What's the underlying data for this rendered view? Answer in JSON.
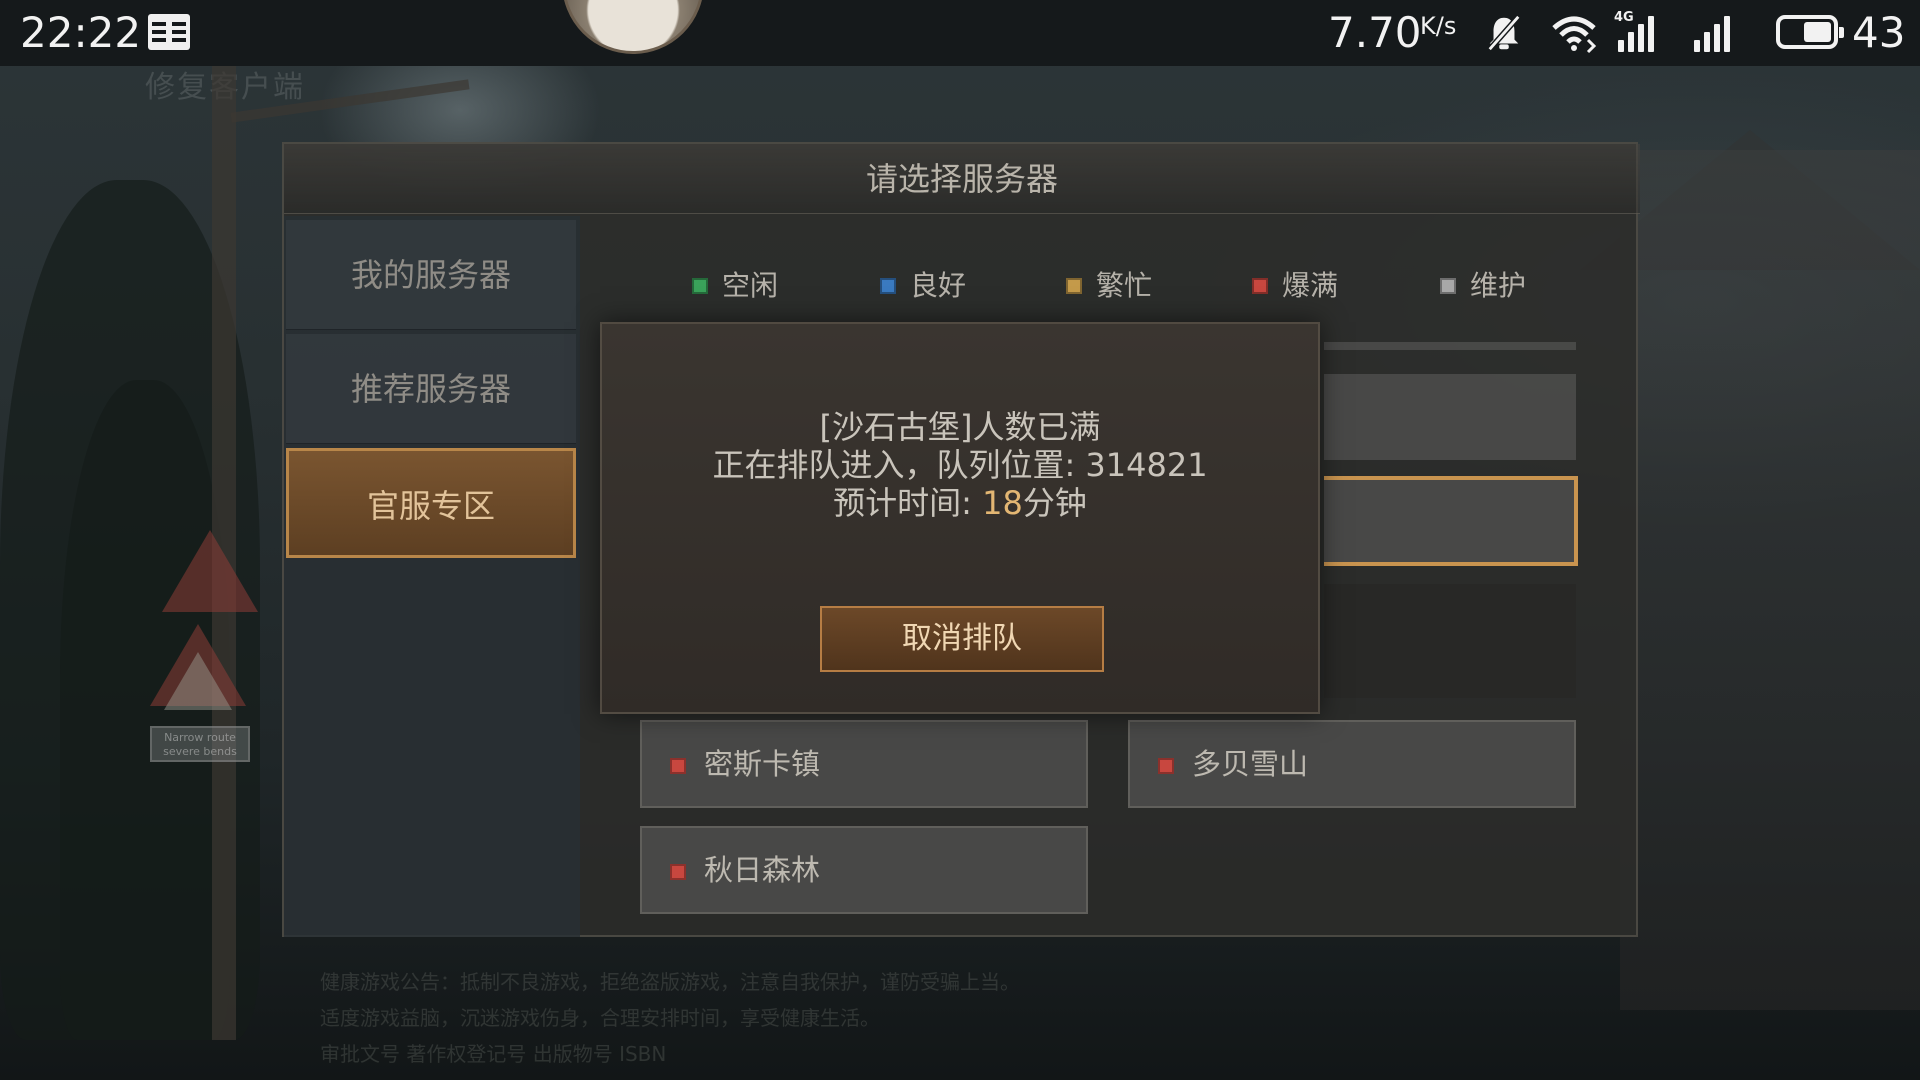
{
  "status_bar": {
    "time": "22:22",
    "net_speed": "7.70",
    "net_speed_unit": "K/s",
    "battery_level": "43",
    "icons": [
      "book-icon",
      "mute-bell-icon",
      "wifi-icon",
      "signal-4g-icon",
      "signal-icon",
      "battery-icon"
    ],
    "network_label": "4G"
  },
  "background": {
    "ghost_title": "修复客户端",
    "footer_lines": [
      "健康游戏公告：抵制不良游戏，拒绝盗版游戏，注意自我保护，谨防受骗上当。",
      "适度游戏益脑，沉迷游戏伤身，合理安排时间，享受健康生活。",
      "审批文号 著作权登记号 出版物号 ISBN"
    ],
    "sign_text": "Narrow route severe bends"
  },
  "panel": {
    "title": "请选择服务器",
    "tabs": [
      {
        "label": "我的服务器",
        "active": false
      },
      {
        "label": "推荐服务器",
        "active": false
      },
      {
        "label": "官服专区",
        "active": true
      }
    ],
    "legend": [
      {
        "label": "空闲",
        "color": "#3aa25a"
      },
      {
        "label": "良好",
        "color": "#3a7ac0"
      },
      {
        "label": "繁忙",
        "color": "#c49a4a"
      },
      {
        "label": "爆满",
        "color": "#c8473f"
      },
      {
        "label": "维护",
        "color": "#a8a8a8"
      }
    ],
    "servers": [
      {
        "name": "密斯卡镇",
        "status_color": "#c8473f"
      },
      {
        "name": "多贝雪山",
        "status_color": "#c8473f"
      },
      {
        "name": "秋日森林",
        "status_color": "#c8473f"
      }
    ]
  },
  "dialog": {
    "line1": "[沙石古堡]人数已满",
    "line2": "正在排队进入，队列位置: 314821",
    "line3_prefix": "预计时间: ",
    "line3_value": "18",
    "line3_suffix": "分钟",
    "cancel_label": "取消排队"
  }
}
